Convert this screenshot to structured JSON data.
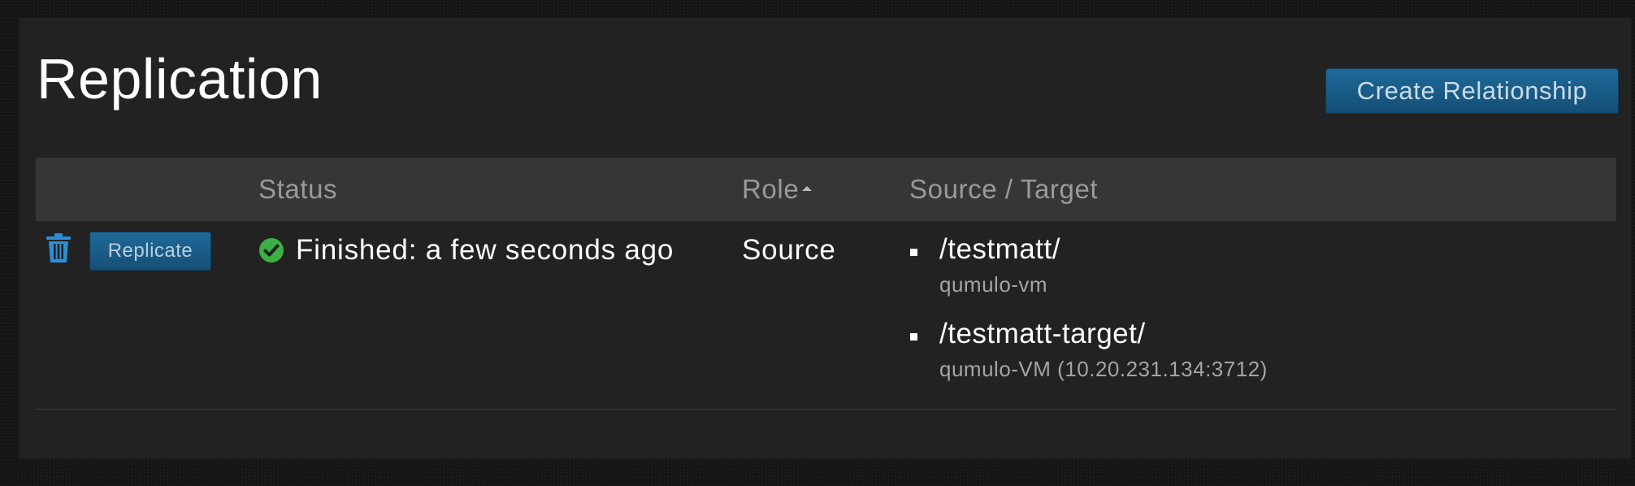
{
  "page": {
    "title": "Replication",
    "create_button_label": "Create Relationship"
  },
  "table": {
    "columns": {
      "status": "Status",
      "role": "Role",
      "source_target": "Source / Target"
    },
    "sort": {
      "column": "Role",
      "direction": "ascending"
    },
    "rows": [
      {
        "actions": {
          "delete_icon": "trash-icon",
          "replicate_label": "Replicate"
        },
        "status": {
          "icon": "check-circle-icon",
          "icon_color": "#3cb043",
          "text": "Finished: a few seconds ago"
        },
        "role": "Source",
        "source": {
          "path": "/testmatt/",
          "host": "qumulo-vm"
        },
        "target": {
          "path": "/testmatt-target/",
          "host": "qumulo-VM (10.20.231.134:3712)"
        }
      }
    ]
  },
  "colors": {
    "background": "#161616",
    "panel": "#222222",
    "header_row": "#363636",
    "button": "#1a5d8a",
    "icon_blue": "#2a8fd6"
  }
}
